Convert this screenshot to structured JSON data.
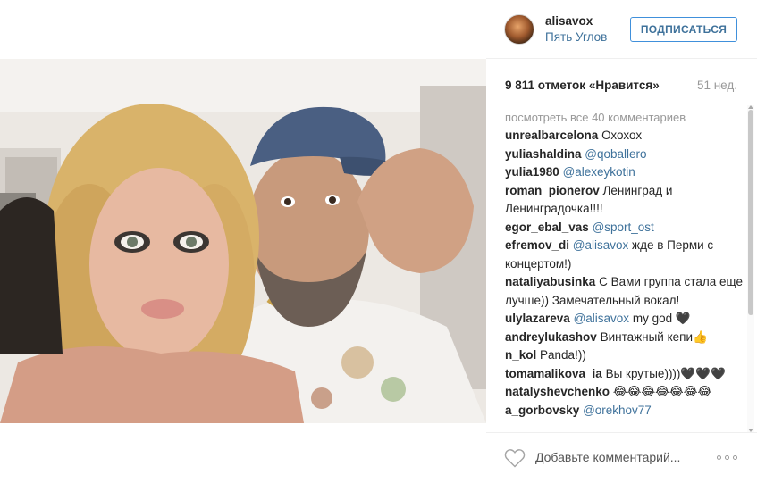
{
  "post": {
    "username": "alisavox",
    "location": "Пять Углов",
    "follow_label": "ПОДПИСАТЬСЯ",
    "likes": "9 811 отметок «Нравится»",
    "time": "51 нед.",
    "view_all": "посмотреть все 40 комментариев",
    "comment_placeholder": "Добавьте комментарий..."
  },
  "comments": [
    {
      "user": "unrealbarcelona",
      "mention": "",
      "text": "Охохох"
    },
    {
      "user": "yuliashaldina",
      "mention": "@qoballero",
      "text": ""
    },
    {
      "user": "yulia1980",
      "mention": "@alexeykotin",
      "text": ""
    },
    {
      "user": "roman_pionerov",
      "mention": "",
      "text": "Ленинград и Ленинградочка!!!!"
    },
    {
      "user": "egor_ebal_vas",
      "mention": "@sport_ost",
      "text": ""
    },
    {
      "user": "efremov_di",
      "mention": "@alisavox",
      "text": "жде в Перми с концертом!)"
    },
    {
      "user": "nataliyabusinka",
      "mention": "",
      "text": "С Вами группа стала еще лучше)) Замечательный вокал!"
    },
    {
      "user": "ulylazareva",
      "mention": "@alisavox",
      "text": "my god 🖤"
    },
    {
      "user": "andreylukashov",
      "mention": "",
      "text": "Винтажный кепи👍"
    },
    {
      "user": "n_kol",
      "mention": "",
      "text": "Panda!))"
    },
    {
      "user": "tomamalikova_ia",
      "mention": "",
      "text": "Вы крутые))))🖤🖤🖤"
    },
    {
      "user": "natalyshevchenko",
      "mention": "",
      "text": "😂😂😂😂😂😂😂"
    },
    {
      "user": "a_gorbovsky",
      "mention": "@orekhov77",
      "text": ""
    }
  ],
  "icons": {
    "like": "heart-outline-icon",
    "more": "more-options-icon"
  },
  "colors": {
    "link": "#3f729b",
    "button_border": "#4090db",
    "muted": "#999999",
    "text": "#262626"
  }
}
